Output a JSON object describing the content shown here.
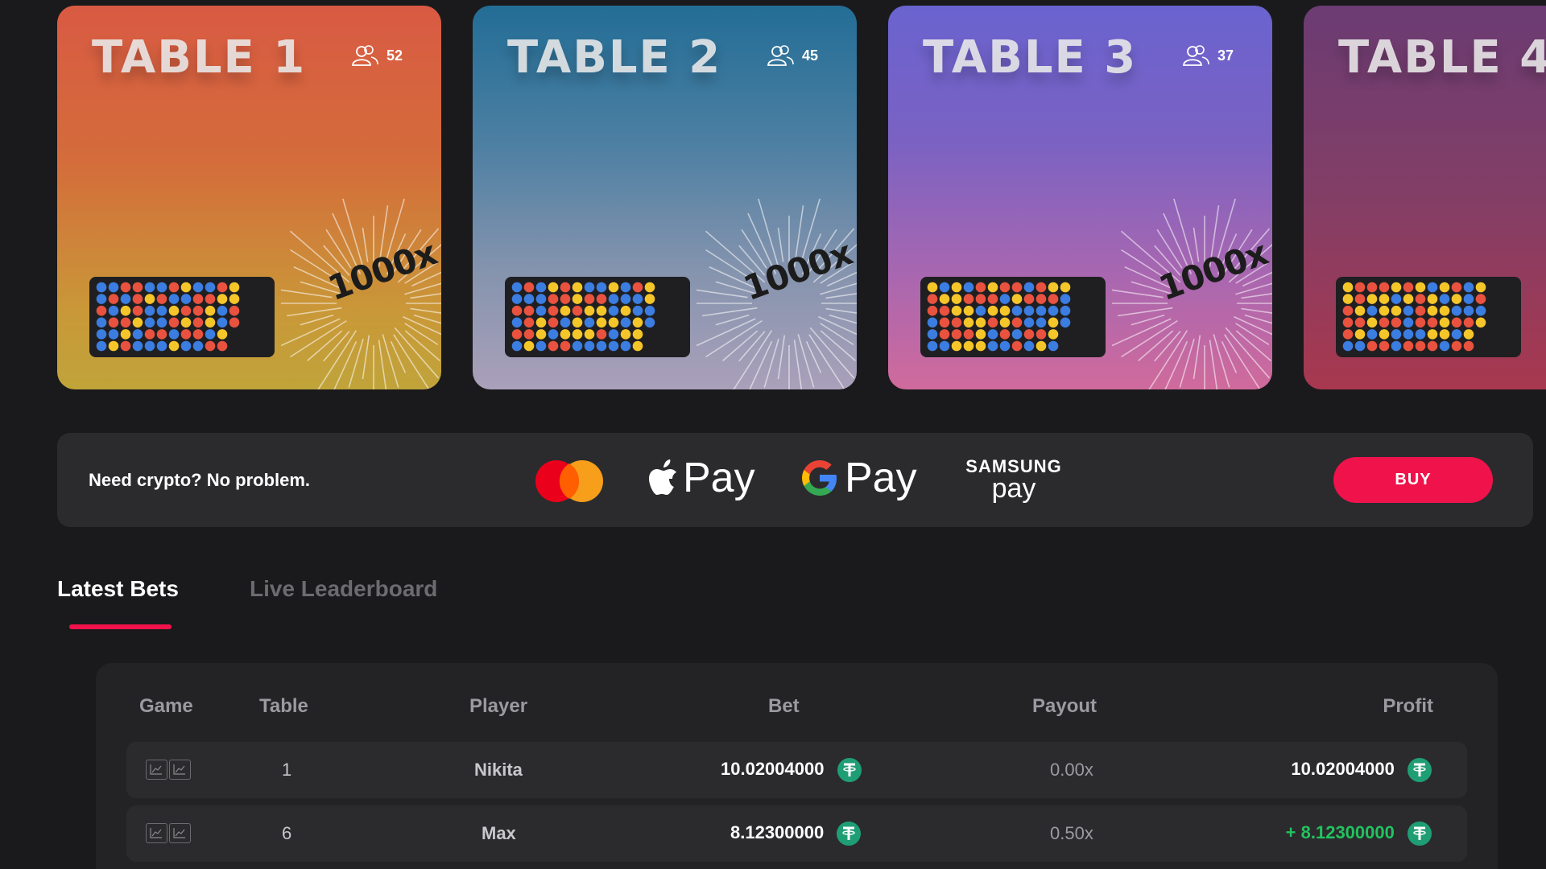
{
  "tables": [
    {
      "title": "TABLE 1",
      "players": "52",
      "multiplier": "1000x"
    },
    {
      "title": "TABLE 2",
      "players": "45",
      "multiplier": "1000x"
    },
    {
      "title": "TABLE 3",
      "players": "37",
      "multiplier": "1000x"
    },
    {
      "title": "TABLE 4",
      "players": "",
      "multiplier": ""
    }
  ],
  "payment": {
    "tagline": "Need crypto? No problem.",
    "apple_pay": "Pay",
    "google_pay": "Pay",
    "samsung_top": "SAMSUNG",
    "samsung_bottom": "pay",
    "buy_label": "BUY"
  },
  "tabs": {
    "active": "Latest Bets",
    "inactive": "Live Leaderboard"
  },
  "bets": {
    "headers": {
      "game": "Game",
      "table": "Table",
      "player": "Player",
      "bet": "Bet",
      "payout": "Payout",
      "profit": "Profit"
    },
    "rows": [
      {
        "table": "1",
        "player": "Nikita",
        "bet": "10.02004000",
        "payout": "0.00x",
        "profit": "10.02004000",
        "profit_positive": false
      },
      {
        "table": "6",
        "player": "Max",
        "bet": "8.12300000",
        "payout": "0.50x",
        "profit": "+ 8.12300000",
        "profit_positive": true
      }
    ]
  },
  "colors": {
    "accent": "#f0124b",
    "ball_red": "#e8523f",
    "ball_blue": "#3b7de0",
    "ball_yellow": "#f5c62a",
    "profit_green": "#22c35e",
    "tether": "#1f9e74"
  },
  "icons": {
    "players": "users-icon",
    "game": "chart-icon",
    "currency": "tether-icon"
  }
}
